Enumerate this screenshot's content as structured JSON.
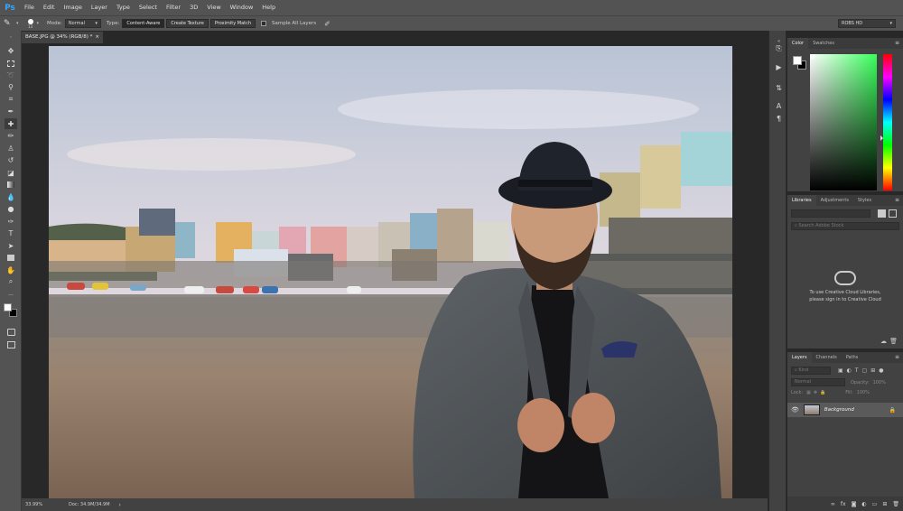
{
  "app": {
    "logo": "Ps"
  },
  "menu": [
    "File",
    "Edit",
    "Image",
    "Layer",
    "Type",
    "Select",
    "Filter",
    "3D",
    "View",
    "Window",
    "Help"
  ],
  "options": {
    "brush_size": "13",
    "mode_label": "Mode:",
    "mode_value": "Normal",
    "type_label": "Type:",
    "type_buttons": [
      "Content-Aware",
      "Create Texture",
      "Proximity Match"
    ],
    "sample_all_layers": "Sample All Layers",
    "workspace": "ROBS HD"
  },
  "document": {
    "tab_title": "BASE.JPG @ 34% (RGB/8) *",
    "zoom": "33.99%",
    "doc_size": "Doc: 34.9M/34.9M"
  },
  "color_panel": {
    "tabs": [
      "Color",
      "Swatches"
    ],
    "foreground": "#ffffff",
    "background": "#000000",
    "hue": "#38ff5a"
  },
  "libraries_panel": {
    "tabs": [
      "Libraries",
      "Adjustments",
      "Styles"
    ],
    "search_placeholder": "Search Adobe Stock",
    "message_line1": "To use Creative Cloud Libraries,",
    "message_line2": "please sign in to Creative Cloud"
  },
  "layers_panel": {
    "tabs": [
      "Layers",
      "Channels",
      "Paths"
    ],
    "kind_label": "Kind",
    "blend_mode": "Normal",
    "opacity_label": "Opacity:",
    "opacity_value": "100%",
    "lock_label": "Lock:",
    "fill_label": "Fill:",
    "fill_value": "100%",
    "layers": [
      {
        "name": "Background",
        "visible": true,
        "locked": true
      }
    ]
  }
}
